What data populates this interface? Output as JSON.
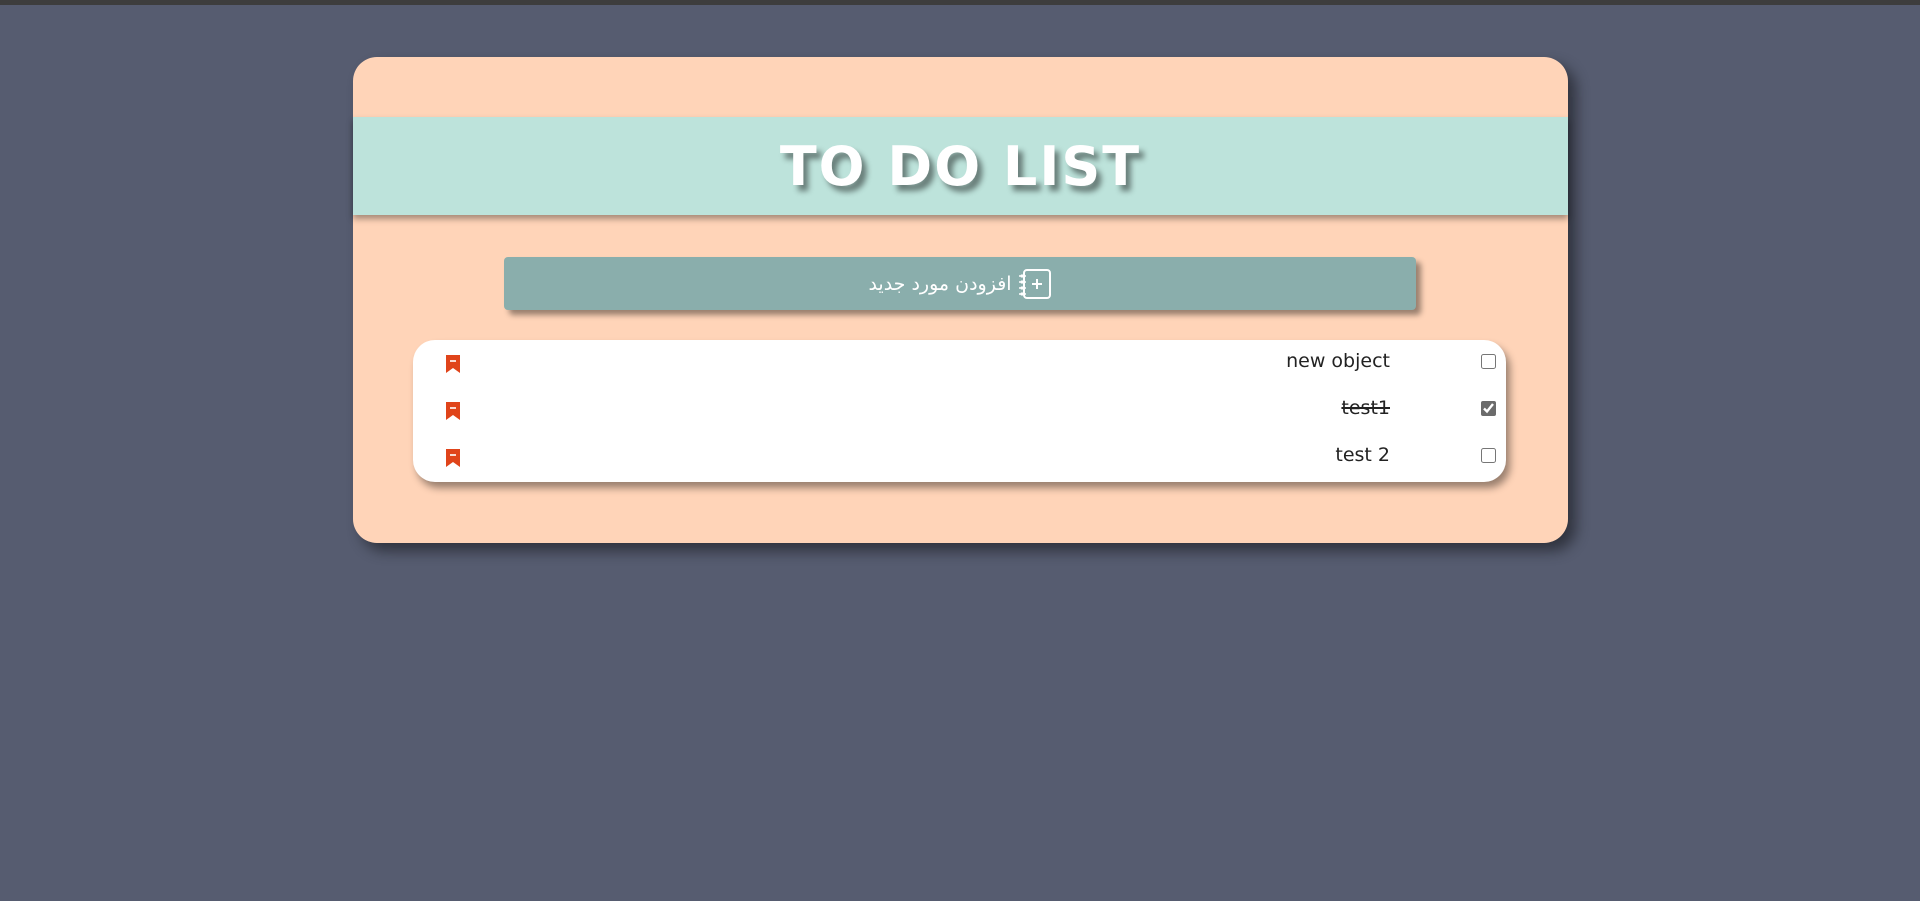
{
  "header": {
    "title": "TO DO LIST"
  },
  "add_button": {
    "label": "افزودن مورد جدید",
    "icon": "notebook-plus-icon"
  },
  "todo_items": [
    {
      "text": "new object",
      "done": false,
      "delete_icon": "bookmark-minus-icon"
    },
    {
      "text": "test1",
      "done": true,
      "delete_icon": "bookmark-minus-icon"
    },
    {
      "text": "test 2",
      "done": false,
      "delete_icon": "bookmark-minus-icon"
    }
  ],
  "colors": {
    "background": "#565c70",
    "card": "#ffd4b8",
    "header_band": "#bde3db",
    "button": "#8aaeac",
    "delete_icon": "#e0441a"
  }
}
